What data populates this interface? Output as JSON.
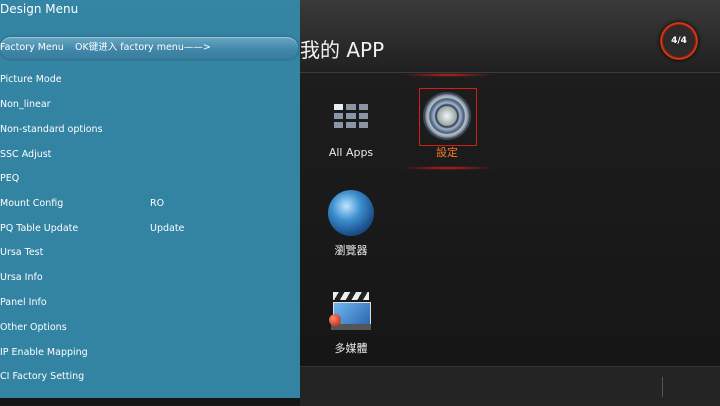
{
  "launcher": {
    "title": "我的 APP",
    "page_indicator": "4/4",
    "apps": [
      {
        "label": "All Apps",
        "icon": "grid-icon"
      },
      {
        "label": "設定",
        "icon": "gear-icon"
      },
      {
        "label": "瀏覽器",
        "icon": "globe-icon"
      },
      {
        "label": "多媒體",
        "icon": "media-icon"
      }
    ],
    "selected_color": "#ff7a2a"
  },
  "menu": {
    "title": "Design Menu",
    "items": [
      {
        "name": "Factory Menu",
        "value": "OK键进入 factory menu——>"
      },
      {
        "name": "Picture Mode",
        "value": ""
      },
      {
        "name": "Non_linear",
        "value": ""
      },
      {
        "name": "Non-standard options",
        "value": ""
      },
      {
        "name": "SSC Adjust",
        "value": ""
      },
      {
        "name": "PEQ",
        "value": ""
      },
      {
        "name": "Mount Config",
        "value": "RO"
      },
      {
        "name": "PQ Table Update",
        "value": "Update"
      },
      {
        "name": "Ursa Test",
        "value": ""
      },
      {
        "name": "Ursa Info",
        "value": ""
      },
      {
        "name": "Panel Info",
        "value": ""
      },
      {
        "name": "Other Options",
        "value": ""
      },
      {
        "name": "IP Enable Mapping",
        "value": ""
      },
      {
        "name": "CI Factory Setting",
        "value": ""
      }
    ],
    "background_color": "#3587a8"
  }
}
